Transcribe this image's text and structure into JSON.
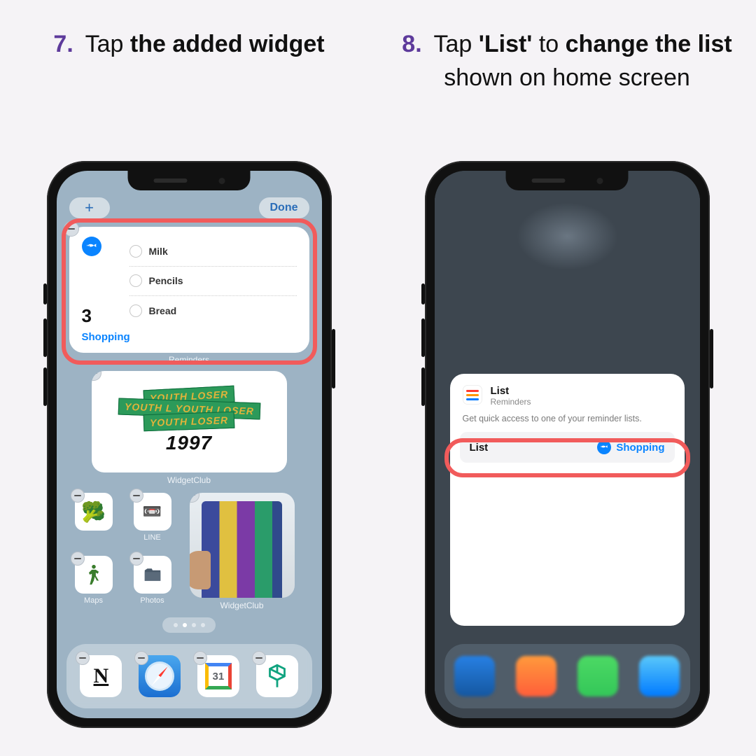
{
  "steps": {
    "s7": {
      "num": "7.",
      "pre": " Tap ",
      "bold": "the added widget"
    },
    "s8": {
      "num": "8.",
      "pre": " Tap ",
      "bold1": "'List'",
      "mid": " to ",
      "bold2": "change the list",
      "post": " shown on home screen"
    }
  },
  "left": {
    "add_glyph": "+",
    "done_label": "Done",
    "reminders": {
      "count": "3",
      "list_name": "Shopping",
      "items": [
        "Milk",
        "Pencils",
        "Bread"
      ],
      "app_label": "Reminders"
    },
    "youth": {
      "strip1": "YOUTH LOSER",
      "strip2": "YOUTH L  YOUTH LOSER",
      "strip3": "YOUTH  LOSER",
      "year": "1997",
      "label": "WidgetClub"
    },
    "small_icons": [
      {
        "label": "",
        "glyph": "🥦"
      },
      {
        "label": "LINE",
        "glyph": "📼"
      },
      {
        "label": "Maps",
        "glyph": ""
      },
      {
        "label": "Photos",
        "glyph": ""
      }
    ],
    "books_label": "WidgetClub",
    "dock": {
      "gcal_day": "31"
    }
  },
  "right": {
    "sheet": {
      "title": "List",
      "subtitle": "Reminders",
      "desc": "Get quick access to one of your reminder lists.",
      "row_label": "List",
      "row_value": "Shopping"
    }
  }
}
